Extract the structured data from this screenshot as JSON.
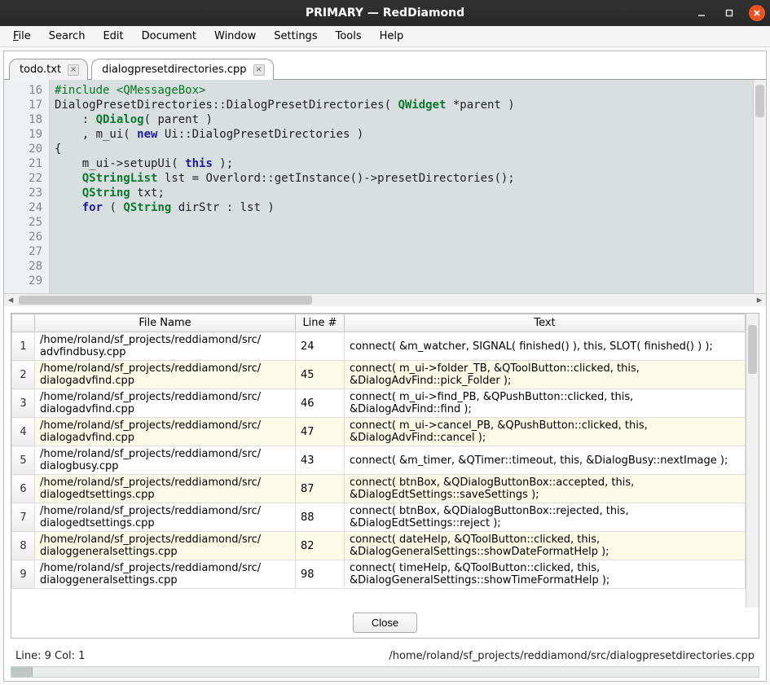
{
  "window": {
    "title": "PRIMARY — RedDiamond"
  },
  "menubar": {
    "items": [
      "File",
      "Search",
      "Edit",
      "Document",
      "Window",
      "Settings",
      "Tools",
      "Help"
    ]
  },
  "tabs": [
    {
      "label": "todo.txt",
      "active": false
    },
    {
      "label": "dialogpresetdirectories.cpp",
      "active": true
    }
  ],
  "editor": {
    "first_line_no": 16,
    "lines": [
      {
        "n": 16,
        "tokens": [
          [
            "comment",
            "#include <QMessageBox>"
          ]
        ]
      },
      {
        "n": 17,
        "tokens": [
          [
            "plain",
            ""
          ]
        ]
      },
      {
        "n": 18,
        "tokens": [
          [
            "plain",
            ""
          ]
        ]
      },
      {
        "n": 19,
        "tokens": [
          [
            "plain",
            "DialogPresetDirectories::DialogPresetDirectories( "
          ],
          [
            "type",
            "QWidget"
          ],
          [
            "plain",
            " *parent )"
          ]
        ]
      },
      {
        "n": 20,
        "tokens": [
          [
            "plain",
            "    : "
          ],
          [
            "type",
            "QDialog"
          ],
          [
            "plain",
            "( parent )"
          ]
        ]
      },
      {
        "n": 21,
        "tokens": [
          [
            "plain",
            "    , m_ui( "
          ],
          [
            "kw",
            "new"
          ],
          [
            "plain",
            " Ui::DialogPresetDirectories )"
          ]
        ]
      },
      {
        "n": 22,
        "tokens": [
          [
            "plain",
            "{"
          ]
        ]
      },
      {
        "n": 23,
        "tokens": [
          [
            "plain",
            "    m_ui->setupUi( "
          ],
          [
            "kw",
            "this"
          ],
          [
            "plain",
            " );"
          ]
        ]
      },
      {
        "n": 24,
        "tokens": [
          [
            "plain",
            ""
          ]
        ]
      },
      {
        "n": 25,
        "tokens": [
          [
            "plain",
            "    "
          ],
          [
            "type",
            "QStringList"
          ],
          [
            "plain",
            " lst = Overlord::getInstance()->presetDirectories();"
          ]
        ]
      },
      {
        "n": 26,
        "tokens": [
          [
            "plain",
            ""
          ]
        ]
      },
      {
        "n": 27,
        "tokens": [
          [
            "plain",
            "    "
          ],
          [
            "type",
            "QString"
          ],
          [
            "plain",
            " txt;"
          ]
        ]
      },
      {
        "n": 28,
        "tokens": [
          [
            "plain",
            ""
          ]
        ]
      },
      {
        "n": 29,
        "tokens": [
          [
            "plain",
            "    "
          ],
          [
            "kw",
            "for"
          ],
          [
            "plain",
            " ( "
          ],
          [
            "type",
            "QString"
          ],
          [
            "plain",
            " dirStr : lst )"
          ]
        ]
      }
    ]
  },
  "results": {
    "headers": {
      "rownum": "",
      "file": "File Name",
      "line": "Line #",
      "text": "Text"
    },
    "rows": [
      {
        "num": "1",
        "file": "/home/roland/sf_projects/reddiamond/src/advfindbusy.cpp",
        "line": "24",
        "text": "connect( &m_watcher, SIGNAL( finished() ), this, SLOT( finished() ) );",
        "alt": false
      },
      {
        "num": "2",
        "file": "/home/roland/sf_projects/reddiamond/src/dialogadvfind.cpp",
        "line": "45",
        "text": "connect( m_ui->folder_TB, &QToolButton::clicked, this, &DialogAdvFind::pick_Folder );",
        "alt": true
      },
      {
        "num": "3",
        "file": "/home/roland/sf_projects/reddiamond/src/dialogadvfind.cpp",
        "line": "46",
        "text": "connect( m_ui->find_PB,   &QPushButton::clicked, this, &DialogAdvFind::find );",
        "alt": false
      },
      {
        "num": "4",
        "file": "/home/roland/sf_projects/reddiamond/src/dialogadvfind.cpp",
        "line": "47",
        "text": "connect( m_ui->cancel_PB, &QPushButton::clicked, this, &DialogAdvFind::cancel );",
        "alt": true
      },
      {
        "num": "5",
        "file": "/home/roland/sf_projects/reddiamond/src/dialogbusy.cpp",
        "line": "43",
        "text": "connect( &m_timer, &QTimer::timeout, this, &DialogBusy::nextImage );",
        "alt": false
      },
      {
        "num": "6",
        "file": "/home/roland/sf_projects/reddiamond/src/dialogedtsettings.cpp",
        "line": "87",
        "text": "connect( btnBox, &QDialogButtonBox::accepted, this, &DialogEdtSettings::saveSettings );",
        "alt": true
      },
      {
        "num": "7",
        "file": "/home/roland/sf_projects/reddiamond/src/dialogedtsettings.cpp",
        "line": "88",
        "text": "connect( btnBox, &QDialogButtonBox::rejected, this, &DialogEdtSettings::reject );",
        "alt": false
      },
      {
        "num": "8",
        "file": "/home/roland/sf_projects/reddiamond/src/dialoggeneralsettings.cpp",
        "line": "82",
        "text": "connect( dateHelp, &QToolButton::clicked, this, &DialogGeneralSettings::showDateFormatHelp );",
        "alt": true
      },
      {
        "num": "9",
        "file": "/home/roland/sf_projects/reddiamond/src/dialoggeneralsettings.cpp",
        "line": "98",
        "text": "connect( timeHelp, &QToolButton::clicked, this, &DialogGeneralSettings::showTimeFormatHelp );",
        "alt": false
      }
    ],
    "close_label": "Close"
  },
  "status": {
    "position": "Line: 9  Col: 1",
    "path": "/home/roland/sf_projects/reddiamond/src/dialogpresetdirectories.cpp"
  }
}
